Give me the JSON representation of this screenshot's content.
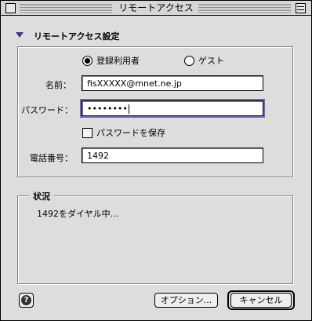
{
  "window": {
    "title": "リモートアクセス"
  },
  "section": {
    "title": "リモートアクセス設定"
  },
  "connect_as": {
    "registered_label": "登録利用者",
    "guest_label": "ゲスト",
    "selected": "registered"
  },
  "form": {
    "name_label": "名前：",
    "name_value": "fisXXXXX@mnet.ne.jp",
    "password_label": "パスワード：",
    "password_value": "••••••••",
    "save_password_label": "パスワードを保存",
    "save_password_checked": false,
    "phone_label": "電話番号：",
    "phone_value": "1492"
  },
  "status": {
    "title": "状況",
    "message": "1492をダイヤル中..."
  },
  "buttons": {
    "help": "?",
    "options": "オプション...",
    "cancel": "キャンセル"
  }
}
